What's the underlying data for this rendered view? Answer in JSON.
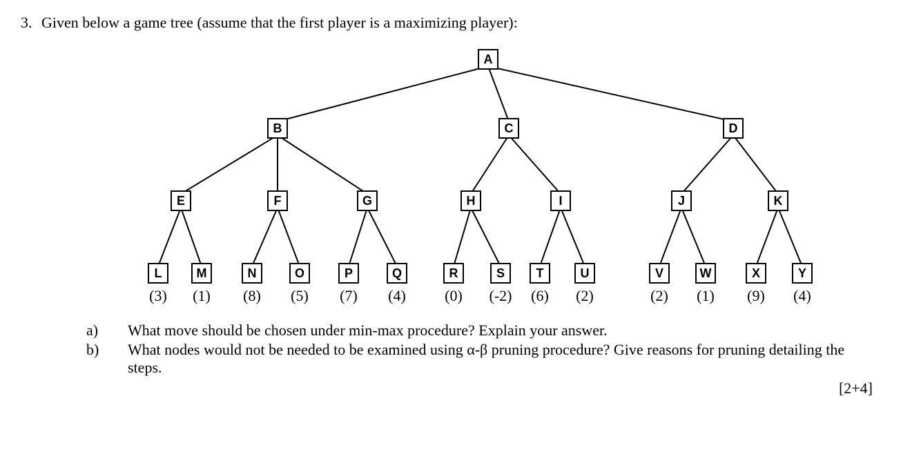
{
  "question_number": "3.",
  "question_stem": "Given below a game tree (assume that the first player is a maximizing player):",
  "tree": {
    "root": "A",
    "level1": [
      "B",
      "C",
      "D"
    ],
    "level2": [
      "E",
      "F",
      "G",
      "H",
      "I",
      "J",
      "K"
    ],
    "leaves": [
      {
        "label": "L",
        "value": "(3)"
      },
      {
        "label": "M",
        "value": "(1)"
      },
      {
        "label": "N",
        "value": "(8)"
      },
      {
        "label": "O",
        "value": "(5)"
      },
      {
        "label": "P",
        "value": "(7)"
      },
      {
        "label": "Q",
        "value": "(4)"
      },
      {
        "label": "R",
        "value": "(0)"
      },
      {
        "label": "S",
        "value": "(-2)"
      },
      {
        "label": "T",
        "value": "(6)"
      },
      {
        "label": "U",
        "value": "(2)"
      },
      {
        "label": "V",
        "value": "(2)"
      },
      {
        "label": "W",
        "value": "(1)"
      },
      {
        "label": "X",
        "value": "(9)"
      },
      {
        "label": "Y",
        "value": "(4)"
      }
    ]
  },
  "parts": {
    "a": {
      "label": "a)",
      "text": "What move should be chosen under min-max procedure? Explain your answer."
    },
    "b": {
      "label": "b)",
      "text": "What nodes would not be needed to be examined using α-β pruning procedure? Give reasons for pruning detailing the steps."
    }
  },
  "marks": "[2+4]"
}
